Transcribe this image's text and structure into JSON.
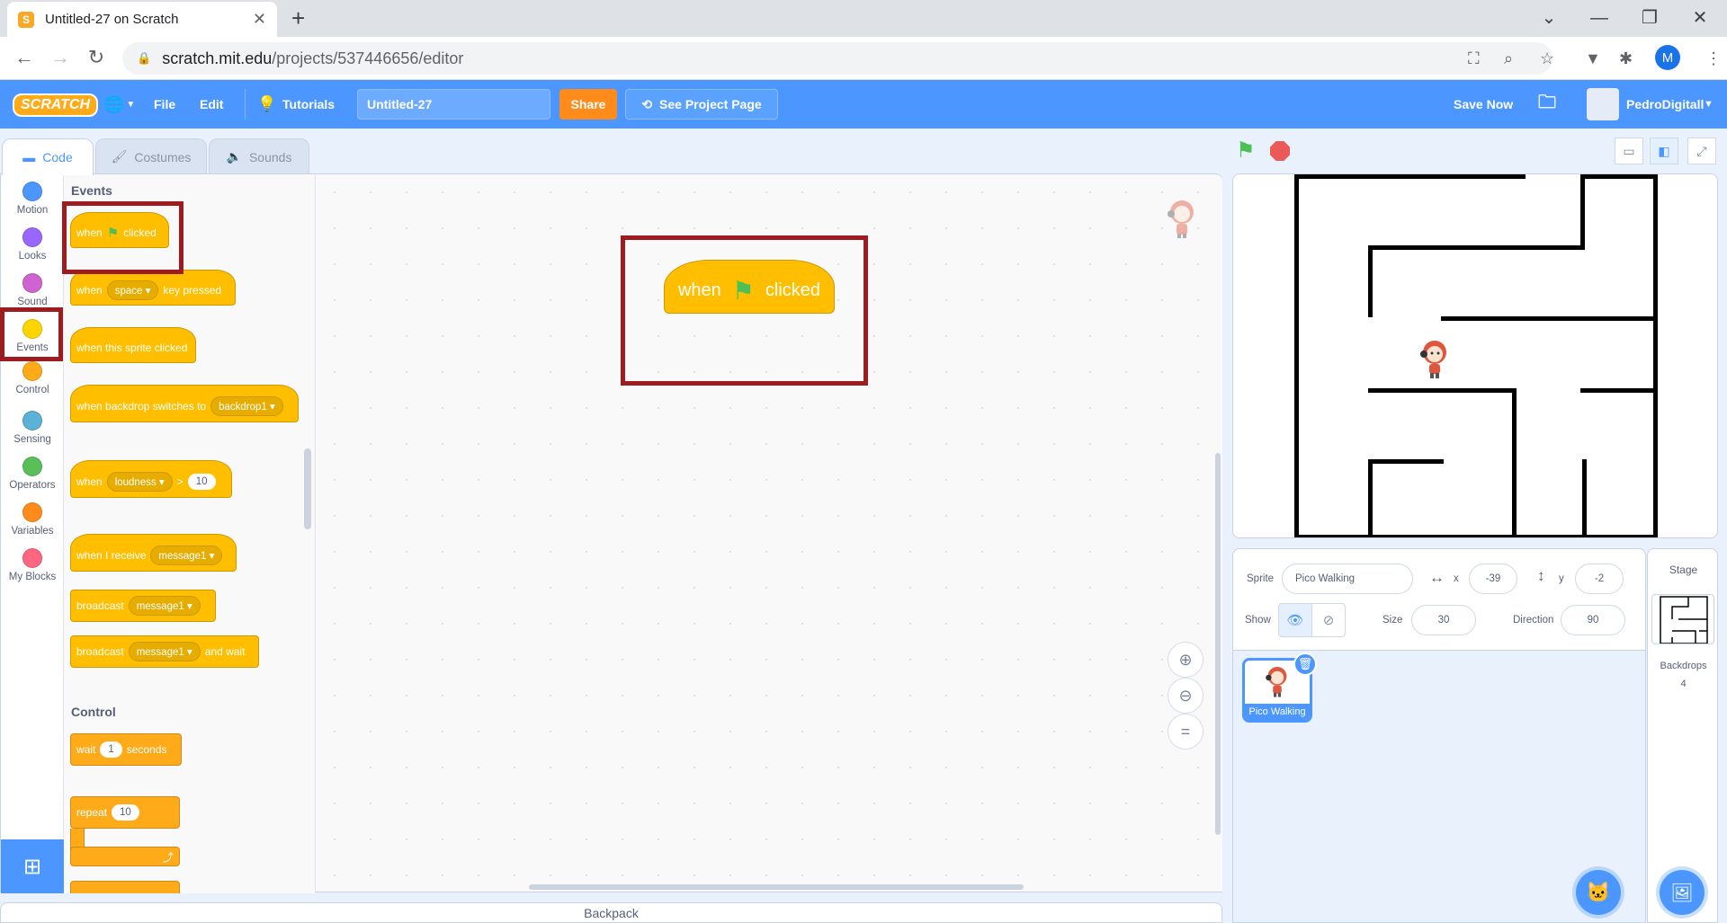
{
  "browser": {
    "tab_title": "Untitled-27 on Scratch",
    "favicon_letter": "S",
    "url_host": "scratch.mit.edu",
    "url_path": "/projects/537446656/editor",
    "profile_initial": "M"
  },
  "menu": {
    "logo": "SCRATCH",
    "file": "File",
    "edit": "Edit",
    "tutorials": "Tutorials",
    "project_title": "Untitled-27",
    "share": "Share",
    "see_project_page": "See Project Page",
    "save_now": "Save Now",
    "username": "PedroDigitall"
  },
  "editor_tabs": {
    "code": "Code",
    "costumes": "Costumes",
    "sounds": "Sounds"
  },
  "categories": [
    {
      "label": "Motion",
      "color": "#4c97ff"
    },
    {
      "label": "Looks",
      "color": "#9966ff"
    },
    {
      "label": "Sound",
      "color": "#cf63cf"
    },
    {
      "label": "Events",
      "color": "#ffd500"
    },
    {
      "label": "Control",
      "color": "#ffab19"
    },
    {
      "label": "Sensing",
      "color": "#5cb1d6"
    },
    {
      "label": "Operators",
      "color": "#59c059"
    },
    {
      "label": "Variables",
      "color": "#ff8c1a"
    },
    {
      "label": "My Blocks",
      "color": "#ff6680"
    }
  ],
  "palette": {
    "events_heading": "Events",
    "control_heading": "Control",
    "when_flag": {
      "when": "when",
      "clicked": "clicked"
    },
    "when_key": {
      "when": "when",
      "key": "space",
      "pressed": "key pressed"
    },
    "when_sprite_clicked": "when this sprite clicked",
    "when_backdrop": {
      "text": "when backdrop switches to",
      "value": "backdrop1"
    },
    "when_loudness": {
      "when": "when",
      "sensor": "loudness",
      "op": ">",
      "value": "10"
    },
    "when_receive": {
      "text": "when I receive",
      "value": "message1"
    },
    "broadcast": {
      "text": "broadcast",
      "value": "message1"
    },
    "broadcast_wait": {
      "text": "broadcast",
      "value": "message1",
      "suffix": "and wait"
    },
    "wait": {
      "text": "wait",
      "value": "1",
      "suffix": "seconds"
    },
    "repeat": {
      "text": "repeat",
      "value": "10"
    }
  },
  "script": {
    "when": "when",
    "clicked": "clicked"
  },
  "backpack": "Backpack",
  "sprite_info": {
    "sprite_label": "Sprite",
    "sprite_name": "Pico Walking",
    "x_label": "x",
    "x": "-39",
    "y_label": "y",
    "y": "-2",
    "show_label": "Show",
    "size_label": "Size",
    "size": "30",
    "direction_label": "Direction",
    "direction": "90"
  },
  "sprites": [
    {
      "name": "Pico Walking",
      "selected": true
    }
  ],
  "stage_pane": {
    "title": "Stage",
    "backdrops_label": "Backdrops",
    "backdrops_count": "4"
  }
}
